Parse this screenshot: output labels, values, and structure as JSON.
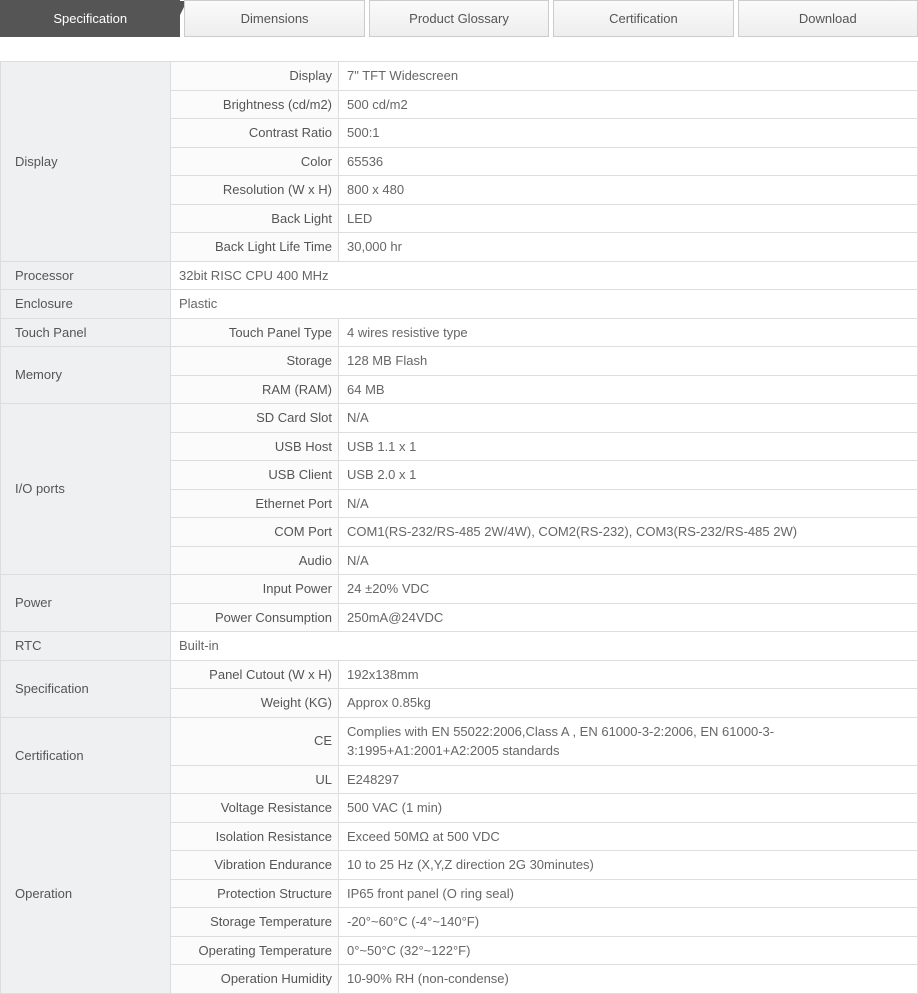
{
  "tabs": [
    {
      "label": "Specification",
      "active": true
    },
    {
      "label": "Dimensions",
      "active": false
    },
    {
      "label": "Product Glossary",
      "active": false
    },
    {
      "label": "Certification",
      "active": false
    },
    {
      "label": "Download",
      "active": false
    }
  ],
  "spec": {
    "display": {
      "category": "Display",
      "rows": [
        {
          "label": "Display",
          "value": "7\" TFT Widescreen"
        },
        {
          "label": "Brightness (cd/m2)",
          "value": "500 cd/m2"
        },
        {
          "label": "Contrast Ratio",
          "value": "500:1"
        },
        {
          "label": "Color",
          "value": "65536"
        },
        {
          "label": "Resolution (W x H)",
          "value": "800 x 480"
        },
        {
          "label": "Back Light",
          "value": "LED"
        },
        {
          "label": "Back Light Life Time",
          "value": "30,000 hr"
        }
      ]
    },
    "processor": {
      "category": "Processor",
      "value": "32bit RISC CPU 400 MHz"
    },
    "enclosure": {
      "category": "Enclosure",
      "value": "Plastic"
    },
    "touch_panel": {
      "category": "Touch Panel",
      "rows": [
        {
          "label": "Touch Panel Type",
          "value": "4 wires resistive type"
        }
      ]
    },
    "memory": {
      "category": "Memory",
      "rows": [
        {
          "label": "Storage",
          "value": "128 MB Flash"
        },
        {
          "label": "RAM (RAM)",
          "value": "64 MB"
        }
      ]
    },
    "io_ports": {
      "category": "I/O ports",
      "rows": [
        {
          "label": "SD Card Slot",
          "value": "N/A"
        },
        {
          "label": "USB Host",
          "value": "USB 1.1 x 1"
        },
        {
          "label": "USB Client",
          "value": "USB 2.0 x 1"
        },
        {
          "label": "Ethernet Port",
          "value": "N/A"
        },
        {
          "label": "COM Port",
          "value": "COM1(RS-232/RS-485 2W/4W), COM2(RS-232), COM3(RS-232/RS-485 2W)"
        },
        {
          "label": "Audio",
          "value": "N/A"
        }
      ]
    },
    "power": {
      "category": "Power",
      "rows": [
        {
          "label": "Input Power",
          "value": "24 ±20% VDC"
        },
        {
          "label": "Power Consumption",
          "value": "250mA@24VDC"
        }
      ]
    },
    "rtc": {
      "category": "RTC",
      "value": "Built-in"
    },
    "specification": {
      "category": "Specification",
      "rows": [
        {
          "label": "Panel Cutout (W x H)",
          "value": "192x138mm"
        },
        {
          "label": "Weight (KG)",
          "value": "Approx 0.85kg"
        }
      ]
    },
    "certification": {
      "category": "Certification",
      "rows": [
        {
          "label": "CE",
          "value": "Complies with EN 55022:2006,Class A , EN 61000-3-2:2006, EN 61000-3-3:1995+A1:2001+A2:2005 standards"
        },
        {
          "label": "UL",
          "value": "E248297"
        }
      ]
    },
    "operation": {
      "category": "Operation",
      "rows": [
        {
          "label": "Voltage Resistance",
          "value": "500 VAC (1 min)"
        },
        {
          "label": "Isolation Resistance",
          "value": "Exceed 50MΩ at 500 VDC"
        },
        {
          "label": "Vibration Endurance",
          "value": "10 to 25 Hz (X,Y,Z direction 2G 30minutes)"
        },
        {
          "label": "Protection Structure",
          "value": "IP65 front panel (O ring seal)"
        },
        {
          "label": "Storage Temperature",
          "value": "-20°~60°C (-4°~140°F)"
        },
        {
          "label": "Operating Temperature",
          "value": "0°~50°C (32°~122°F)"
        },
        {
          "label": "Operation Humidity",
          "value": "10-90% RH (non-condense)"
        }
      ]
    }
  }
}
